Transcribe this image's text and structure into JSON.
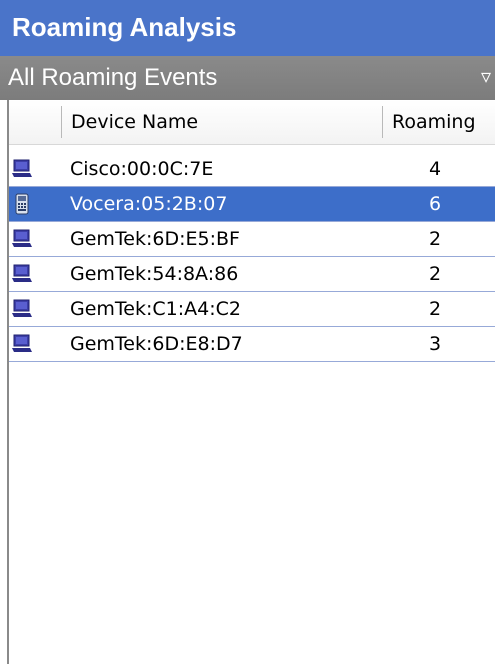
{
  "panel": {
    "title": "Roaming Analysis",
    "filter": {
      "selected": "All Roaming Events",
      "arrow_icon": "dropdown-arrow-icon",
      "arrow_glyph": "▿"
    }
  },
  "table": {
    "columns": [
      "Device Name",
      "Roaming"
    ],
    "rows": [
      {
        "device": "Cisco:00:0C:7E",
        "roaming": "4",
        "icon": "laptop-icon",
        "selected": false
      },
      {
        "device": "Vocera:05:2B:07",
        "roaming": "6",
        "icon": "handheld-device-icon",
        "selected": true
      },
      {
        "device": "GemTek:6D:E5:BF",
        "roaming": "2",
        "icon": "laptop-icon",
        "selected": false
      },
      {
        "device": "GemTek:54:8A:86",
        "roaming": "2",
        "icon": "laptop-icon",
        "selected": false
      },
      {
        "device": "GemTek:C1:A4:C2",
        "roaming": "2",
        "icon": "laptop-icon",
        "selected": false
      },
      {
        "device": "GemTek:6D:E8:D7",
        "roaming": "3",
        "icon": "laptop-icon",
        "selected": false
      }
    ]
  },
  "colors": {
    "title_bar": "#4a74c9",
    "filter_bar": "#838383",
    "selection": "#3d6ec9",
    "row_divider": "#97a9d8"
  }
}
